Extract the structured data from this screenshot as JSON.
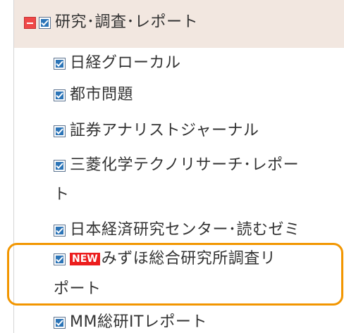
{
  "category": {
    "label": "研究･調査･レポート"
  },
  "items": [
    {
      "label": "日経グローカル"
    },
    {
      "label": "都市問題"
    },
    {
      "label": "証券アナリストジャーナル"
    },
    {
      "label": "三菱化学テクノリサーチ･レポー",
      "continuation": "ト"
    },
    {
      "label": "日本経済研究センター･読むゼミ"
    },
    {
      "label": "みずほ総合研究所調査リ",
      "continuation": "ポート",
      "badge": "NEW"
    },
    {
      "label": "MM総研ITレポート"
    }
  ],
  "colors": {
    "header_bg": "#f2e7e0",
    "checkbox": "#2b74b7",
    "collapse_icon": "#ef4848",
    "new_badge": "#ec1d1d",
    "highlight_border": "#f29600"
  },
  "icons": {
    "collapse": "minus-box-icon",
    "checkbox": "checked-checkbox-icon"
  }
}
